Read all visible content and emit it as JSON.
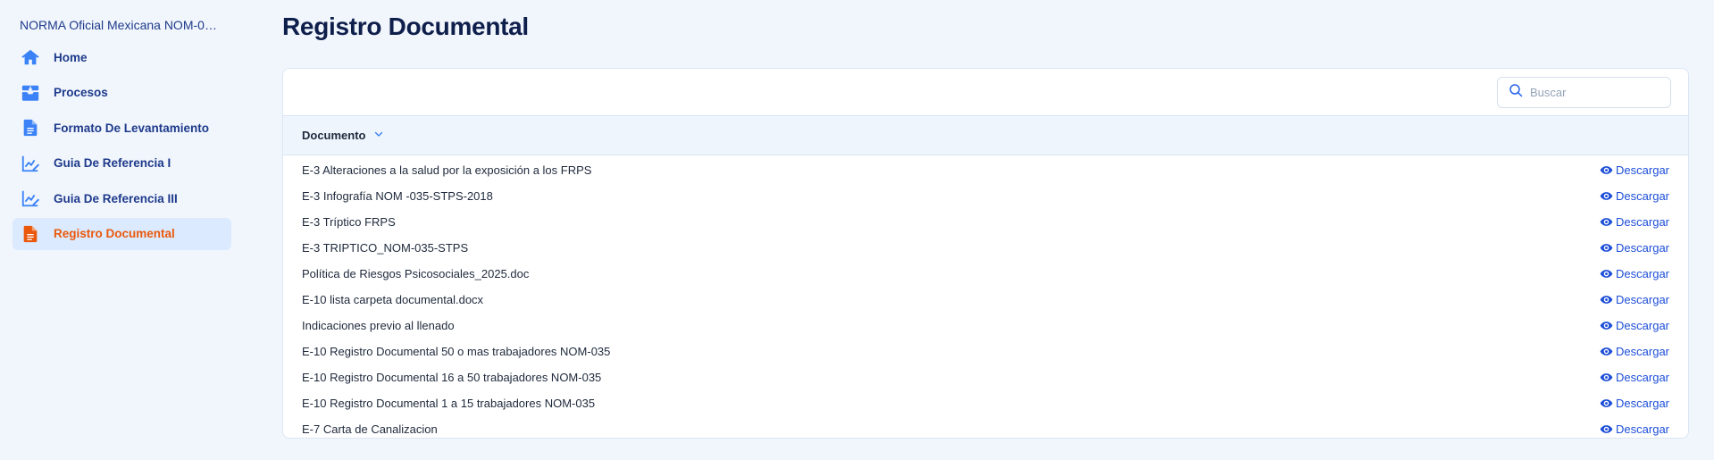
{
  "brand": "NORMA Oficial Mexicana NOM-035-S...",
  "nav": [
    {
      "label": "Home",
      "icon": "home-icon",
      "active": false
    },
    {
      "label": "Procesos",
      "icon": "inbox-tray-icon",
      "active": false
    },
    {
      "label": "Formato De Levantamiento",
      "icon": "document-icon",
      "active": false
    },
    {
      "label": "Guia De Referencia I",
      "icon": "chart-edit-icon",
      "active": false
    },
    {
      "label": "Guia De Referencia III",
      "icon": "chart-edit-icon",
      "active": false
    },
    {
      "label": "Registro Documental",
      "icon": "document-icon",
      "active": true
    }
  ],
  "page": {
    "title": "Registro Documental"
  },
  "search": {
    "placeholder": "Buscar",
    "value": ""
  },
  "table": {
    "column": "Documento",
    "action_label": "Descargar",
    "rows": [
      "E-3 Alteraciones a la salud por la exposición a los FRPS",
      "E-3 Infografía NOM -035-STPS-2018",
      "E-3 Tríptico FRPS",
      "E-3 TRIPTICO_NOM-035-STPS",
      "Política de Riesgos Psicosociales_2025.doc",
      "E-10 lista carpeta documental.docx",
      "Indicaciones previo al llenado",
      "E-10 Registro Documental 50 o mas trabajadores NOM-035",
      "E-10 Registro Documental 16 a 50 trabajadores NOM-035",
      "E-10 Registro Documental 1 a 15 trabajadores NOM-035",
      "E-7 Carta de Canalizacion"
    ]
  },
  "colors": {
    "accent": "#1d4ed8",
    "active": "#ea580c",
    "nav_icon": "#3b82f6"
  }
}
